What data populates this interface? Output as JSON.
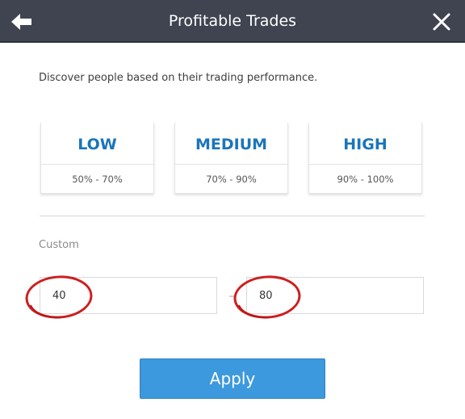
{
  "header": {
    "title": "Profitable Trades",
    "back_icon": "arrow-left-icon",
    "close_icon": "close-icon",
    "background": "#3f4450"
  },
  "description": "Discover people based on their trading performance.",
  "tiers": [
    {
      "label": "LOW",
      "range": "50% - 70%"
    },
    {
      "label": "MEDIUM",
      "range": "70% - 90%"
    },
    {
      "label": "HIGH",
      "range": "90% - 100%"
    }
  ],
  "custom": {
    "label": "Custom",
    "min_value": "40",
    "max_value": "80",
    "annotation_color": "#cc1f1f"
  },
  "apply_label": "Apply",
  "colors": {
    "accent": "#1b75bb",
    "button": "#3d99dd"
  }
}
